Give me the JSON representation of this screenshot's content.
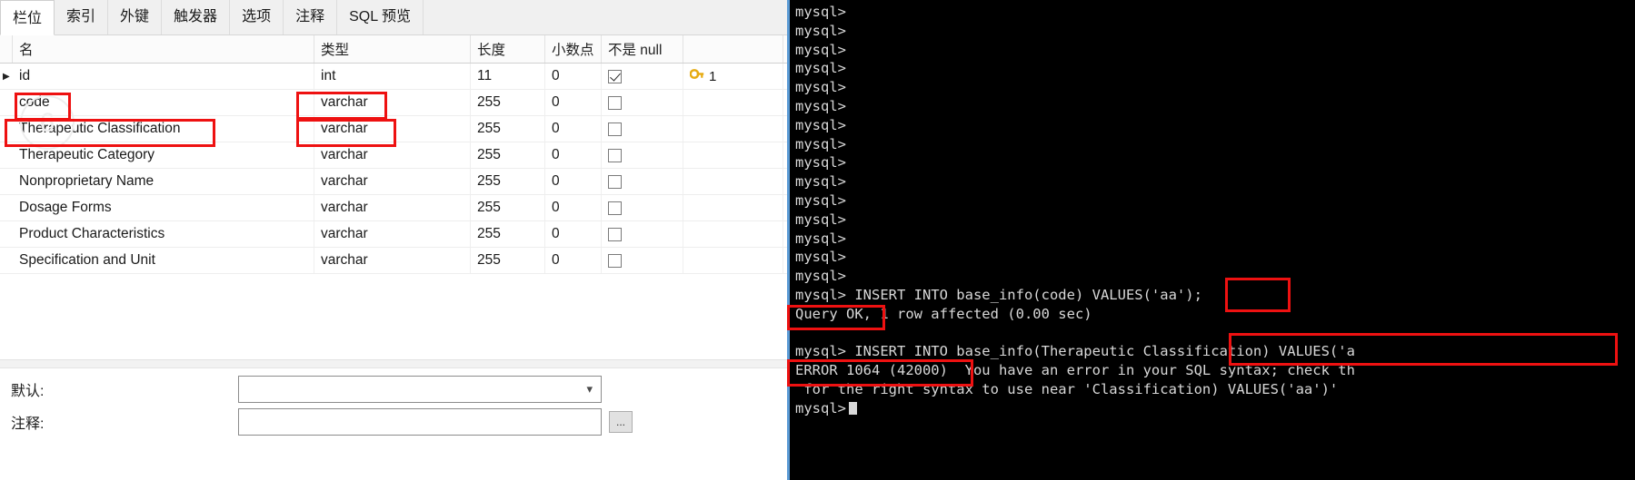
{
  "tabs": [
    {
      "label": "栏位",
      "active": true
    },
    {
      "label": "索引",
      "active": false
    },
    {
      "label": "外键",
      "active": false
    },
    {
      "label": "触发器",
      "active": false
    },
    {
      "label": "选项",
      "active": false
    },
    {
      "label": "注释",
      "active": false
    },
    {
      "label": "SQL 预览",
      "active": false
    }
  ],
  "grid": {
    "headers": {
      "marker": "",
      "name": "名",
      "type": "类型",
      "length": "长度",
      "decimals": "小数点",
      "notnull": "不是 null",
      "key": ""
    },
    "rows": [
      {
        "marker": "▶",
        "name": "id",
        "type": "int",
        "length": "11",
        "decimals": "0",
        "notnull": true,
        "key": "1",
        "key_icon": "key-icon"
      },
      {
        "marker": "",
        "name": "code",
        "type": "varchar",
        "length": "255",
        "decimals": "0",
        "notnull": false,
        "key": "",
        "key_icon": ""
      },
      {
        "marker": "",
        "name": "Therapeutic Classification",
        "type": "varchar",
        "length": "255",
        "decimals": "0",
        "notnull": false,
        "key": "",
        "key_icon": ""
      },
      {
        "marker": "",
        "name": "Therapeutic Category",
        "type": "varchar",
        "length": "255",
        "decimals": "0",
        "notnull": false,
        "key": "",
        "key_icon": ""
      },
      {
        "marker": "",
        "name": "Nonproprietary Name",
        "type": "varchar",
        "length": "255",
        "decimals": "0",
        "notnull": false,
        "key": "",
        "key_icon": ""
      },
      {
        "marker": "",
        "name": "Dosage Forms",
        "type": "varchar",
        "length": "255",
        "decimals": "0",
        "notnull": false,
        "key": "",
        "key_icon": ""
      },
      {
        "marker": "",
        "name": "Product Characteristics",
        "type": "varchar",
        "length": "255",
        "decimals": "0",
        "notnull": false,
        "key": "",
        "key_icon": ""
      },
      {
        "marker": "",
        "name": "Specification and Unit",
        "type": "varchar",
        "length": "255",
        "decimals": "0",
        "notnull": false,
        "key": "",
        "key_icon": ""
      }
    ]
  },
  "properties": {
    "default_label": "默认:",
    "default_value": "",
    "comment_label": "注释:",
    "comment_value": "",
    "dropdown_icon": "chevron-down-icon",
    "ellipsis_label": "..."
  },
  "terminal": {
    "lines": [
      "mysql>",
      "mysql>",
      "mysql>",
      "mysql>",
      "mysql>",
      "mysql>",
      "mysql>",
      "mysql>",
      "mysql>",
      "mysql>",
      "mysql>",
      "mysql>",
      "mysql>",
      "mysql>",
      "mysql>",
      "mysql> INSERT INTO base_info(code) VALUES('aa');",
      "Query OK, 1 row affected (0.00 sec)",
      "",
      "mysql> INSERT INTO base_info(Therapeutic Classification) VALUES('a",
      "ERROR 1064 (42000)  You have an error in your SQL syntax; check th",
      " for the right syntax to use near 'Classification) VALUES('aa')' ",
      "mysql>"
    ],
    "cursor": "block-cursor"
  },
  "annotations": {
    "color": "#ee1111",
    "boxes": [
      {
        "name": "highlight-code-field-name"
      },
      {
        "name": "highlight-code-field-type"
      },
      {
        "name": "highlight-therapeutic-classification-name"
      },
      {
        "name": "highlight-therapeutic-classification-type"
      },
      {
        "name": "highlight-terminal-code-column"
      },
      {
        "name": "highlight-query-ok"
      },
      {
        "name": "highlight-terminal-therapeutic-classification"
      },
      {
        "name": "highlight-error-1064"
      }
    ]
  }
}
